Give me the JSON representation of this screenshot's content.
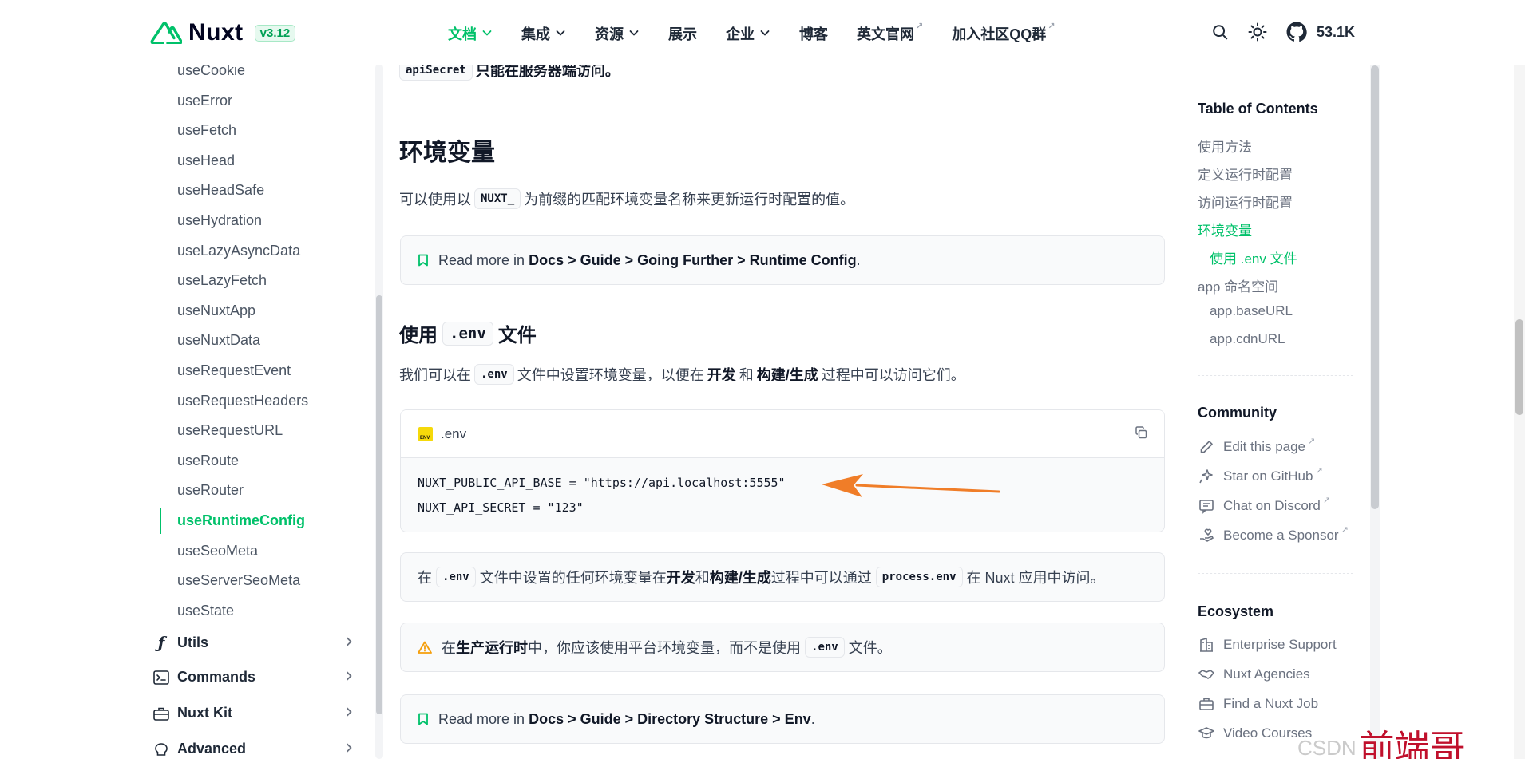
{
  "header": {
    "logo_text": "Nuxt",
    "version": "v3.12",
    "nav": [
      {
        "label": "文档",
        "active": true,
        "has_dropdown": true,
        "external": false
      },
      {
        "label": "集成",
        "active": false,
        "has_dropdown": true,
        "external": false
      },
      {
        "label": "资源",
        "active": false,
        "has_dropdown": true,
        "external": false
      },
      {
        "label": "展示",
        "active": false,
        "has_dropdown": false,
        "external": false
      },
      {
        "label": "企业",
        "active": false,
        "has_dropdown": true,
        "external": false
      },
      {
        "label": "博客",
        "active": false,
        "has_dropdown": false,
        "external": false
      },
      {
        "label": "英文官网",
        "active": false,
        "has_dropdown": false,
        "external": true
      },
      {
        "label": "加入社区QQ群",
        "active": false,
        "has_dropdown": false,
        "external": true
      }
    ],
    "github_stars": "53.1K",
    "icons": [
      "search-icon",
      "sun-icon",
      "github-icon"
    ]
  },
  "sidebar": {
    "items": [
      {
        "label": "useCookie"
      },
      {
        "label": "useError"
      },
      {
        "label": "useFetch"
      },
      {
        "label": "useHead"
      },
      {
        "label": "useHeadSafe"
      },
      {
        "label": "useHydration"
      },
      {
        "label": "useLazyAsyncData"
      },
      {
        "label": "useLazyFetch"
      },
      {
        "label": "useNuxtApp"
      },
      {
        "label": "useNuxtData"
      },
      {
        "label": "useRequestEvent"
      },
      {
        "label": "useRequestHeaders"
      },
      {
        "label": "useRequestURL"
      },
      {
        "label": "useRoute"
      },
      {
        "label": "useRouter"
      },
      {
        "label": "useRuntimeConfig",
        "active": true
      },
      {
        "label": "useSeoMeta"
      },
      {
        "label": "useServerSeoMeta"
      },
      {
        "label": "useState"
      }
    ],
    "groups": [
      {
        "label": "Utils",
        "icon": "function-icon"
      },
      {
        "label": "Commands",
        "icon": "terminal-icon"
      },
      {
        "label": "Nuxt Kit",
        "icon": "toolbox-icon"
      },
      {
        "label": "Advanced",
        "icon": "brain-icon"
      }
    ]
  },
  "content": {
    "top_note": {
      "code": "apiSecret",
      "text": "只能在服务器端访问。"
    },
    "env_section": {
      "title": "环境变量",
      "para": {
        "pre": "可以使用以",
        "code": "NUXT_",
        "post": "为前缀的匹配环境变量名称来更新运行时配置的值。"
      },
      "read_more": {
        "prefix": "Read more in",
        "path": "Docs > Guide > Going Further > Runtime Config",
        "suffix": "."
      }
    },
    "dotenv_section": {
      "title_pre": "使用",
      "title_code": ".env",
      "title_post": "文件",
      "para": {
        "pre": "我们可以在",
        "code": ".env",
        "mid": "文件中设置环境变量，以便在",
        "b1": "开发",
        "and": "和",
        "b2": "构建/生成",
        "post": "过程中可以访问它们。"
      },
      "codeblock": {
        "filename": ".env",
        "lines": [
          "NUXT_PUBLIC_API_BASE = \"https://api.localhost:5555\"",
          "NUXT_API_SECRET = \"123\""
        ]
      },
      "note": {
        "pre": "在",
        "code1": ".env",
        "mid": "文件中设置的任何环境变量在",
        "b1": "开发",
        "and": "和",
        "b2": "构建/生成",
        "mid2": "过程中可以通过",
        "code2": "process.env",
        "post": "在 Nuxt 应用中访问。"
      },
      "warning": {
        "pre": "在",
        "bold": "生产运行时",
        "mid": "中，你应该使用平台环境变量，而不是使用",
        "code": ".env",
        "post": "文件。"
      },
      "read_more": {
        "prefix": "Read more in",
        "path": "Docs > Guide > Directory Structure > Env",
        "suffix": "."
      }
    }
  },
  "toc": {
    "title": "Table of Contents",
    "links": [
      {
        "label": "使用方法",
        "level": 1,
        "active": false
      },
      {
        "label": "定义运行时配置",
        "level": 1,
        "active": false
      },
      {
        "label": "访问运行时配置",
        "level": 1,
        "active": false
      },
      {
        "label": "环境变量",
        "level": 1,
        "active": true
      },
      {
        "label": "使用 .env 文件",
        "level": 2,
        "active": true
      },
      {
        "label": "app 命名空间",
        "level": 1,
        "active": false
      },
      {
        "label": "app.baseURL",
        "level": 2,
        "active": false
      },
      {
        "label": "app.cdnURL",
        "level": 2,
        "active": false
      }
    ],
    "community_title": "Community",
    "community": [
      {
        "label": "Edit this page",
        "icon": "pencil-icon"
      },
      {
        "label": "Star on GitHub",
        "icon": "sparkle-icon"
      },
      {
        "label": "Chat on Discord",
        "icon": "chat-icon"
      },
      {
        "label": "Become a Sponsor",
        "icon": "hand-heart-icon"
      }
    ],
    "ecosystem_title": "Ecosystem",
    "ecosystem": [
      {
        "label": "Enterprise Support",
        "icon": "building-icon"
      },
      {
        "label": "Nuxt Agencies",
        "icon": "handshake-icon"
      },
      {
        "label": "Find a Nuxt Job",
        "icon": "briefcase-icon"
      },
      {
        "label": "Video Courses",
        "icon": "graduation-cap-icon"
      }
    ]
  },
  "watermark": {
    "text": "CSDN",
    "cn": "前端哥"
  },
  "colors": {
    "accent": "#00c16a",
    "arrow": "#f07d28"
  }
}
